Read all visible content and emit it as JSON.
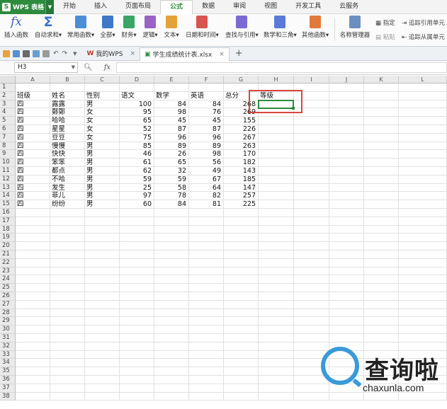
{
  "app": {
    "name": "WPS 表格"
  },
  "menu_tabs": [
    "开始",
    "插入",
    "页面布局",
    "公式",
    "数据",
    "审阅",
    "视图",
    "开发工具",
    "云服务"
  ],
  "active_menu_tab": "公式",
  "ribbon": {
    "insert_function": "插入函数",
    "autosum": "自动求和",
    "common_functions": "常用函数",
    "all": "全部",
    "finance": "财务",
    "logic": "逻辑",
    "text": "文本",
    "datetime": "日期和时间",
    "lookup": "查找与引用",
    "math": "数学和三角",
    "other": "其他函数",
    "name_manager": "名称管理器",
    "specify": "指定",
    "paste": "粘贴",
    "trace_precedents": "追踪引用单元",
    "trace_dependents": "追踪从属单元"
  },
  "tabs": {
    "my_wps": "我的WPS",
    "document": "学生成绩统计表.xlsx",
    "add": "+"
  },
  "formula_bar": {
    "name_box": "H3",
    "fx": "fx",
    "zoom_icon": "magnifier-icon",
    "value": ""
  },
  "grid": {
    "columns": [
      "A",
      "B",
      "C",
      "D",
      "E",
      "F",
      "G",
      "H",
      "I",
      "J",
      "K",
      "L"
    ],
    "rows": [
      [
        "班级",
        "姓名",
        "性别",
        "语文",
        "数学",
        "英语",
        "总分",
        "等级"
      ],
      [
        "四",
        "露露",
        "男",
        "100",
        "84",
        "84",
        "268",
        ""
      ],
      [
        "四",
        "鄭鄭",
        "女",
        "95",
        "98",
        "76",
        "269",
        ""
      ],
      [
        "四",
        "哈哈",
        "女",
        "65",
        "45",
        "45",
        "155",
        ""
      ],
      [
        "四",
        "星星",
        "女",
        "52",
        "87",
        "87",
        "226",
        ""
      ],
      [
        "四",
        "豆豆",
        "女",
        "75",
        "96",
        "96",
        "267",
        ""
      ],
      [
        "四",
        "慢慢",
        "男",
        "85",
        "89",
        "89",
        "263",
        ""
      ],
      [
        "四",
        "快快",
        "男",
        "46",
        "26",
        "98",
        "170",
        ""
      ],
      [
        "四",
        "笨笨",
        "男",
        "61",
        "65",
        "56",
        "182",
        ""
      ],
      [
        "四",
        "都点",
        "男",
        "62",
        "32",
        "49",
        "143",
        ""
      ],
      [
        "四",
        "不哈",
        "男",
        "59",
        "59",
        "67",
        "185",
        ""
      ],
      [
        "四",
        "发生",
        "男",
        "25",
        "58",
        "64",
        "147",
        ""
      ],
      [
        "四",
        "菲儿",
        "男",
        "97",
        "78",
        "82",
        "257",
        ""
      ],
      [
        "四",
        "纷纷",
        "男",
        "60",
        "84",
        "81",
        "225",
        ""
      ]
    ],
    "row_numbers": [
      "1",
      "2",
      "3",
      "4",
      "5",
      "6",
      "7",
      "8",
      "9",
      "10",
      "11",
      "12",
      "13",
      "14",
      "15",
      "16",
      "17",
      "18",
      "19",
      "20",
      "21",
      "22",
      "23",
      "24",
      "25",
      "26",
      "27",
      "28",
      "29",
      "30",
      "31",
      "32",
      "33",
      "34",
      "35",
      "36",
      "37",
      "38"
    ]
  },
  "watermark": {
    "title": "查询啦",
    "url": "chaxunla.com"
  },
  "colors": {
    "accent": "#2e8b3e",
    "highlight": "#d9473f",
    "watermark": "#3a9ad9"
  }
}
